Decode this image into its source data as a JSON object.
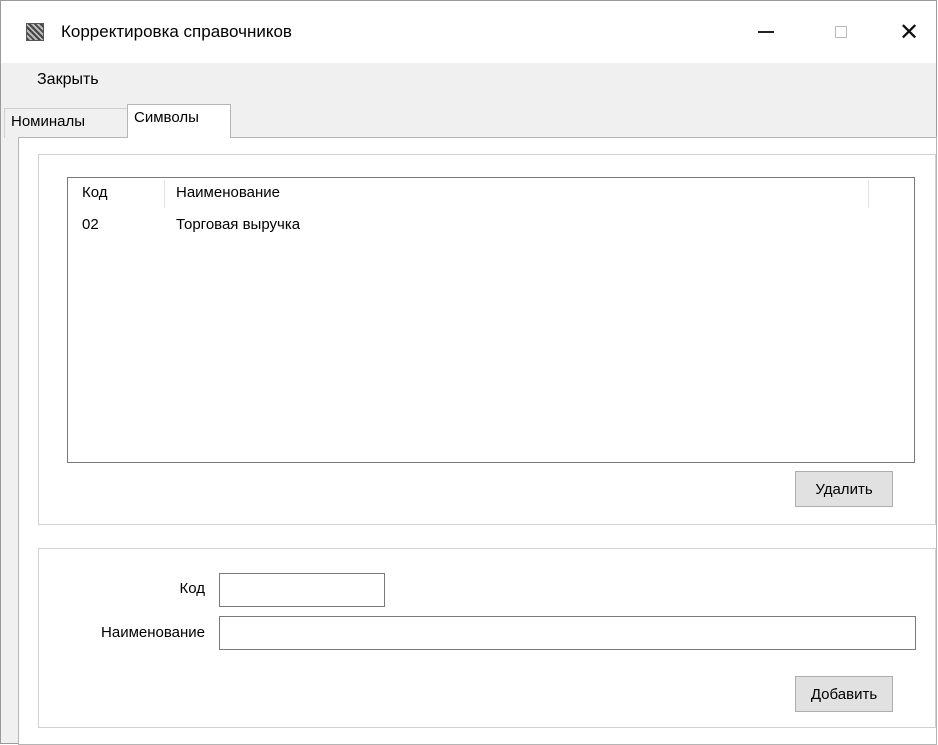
{
  "window": {
    "title": "Корректировка справочников"
  },
  "menu": {
    "items": [
      {
        "label": "Закрыть"
      }
    ]
  },
  "tabs": [
    {
      "label": "Номиналы",
      "active": false
    },
    {
      "label": "Символы",
      "active": true
    }
  ],
  "list": {
    "columns": [
      "Код",
      "Наименование"
    ],
    "rows": [
      {
        "code": "02",
        "name": "Торговая выручка"
      }
    ]
  },
  "buttons": {
    "delete": "Удалить",
    "add": "Добавить"
  },
  "form": {
    "code_label": "Код",
    "name_label": "Наименование",
    "code_value": "",
    "name_value": ""
  }
}
